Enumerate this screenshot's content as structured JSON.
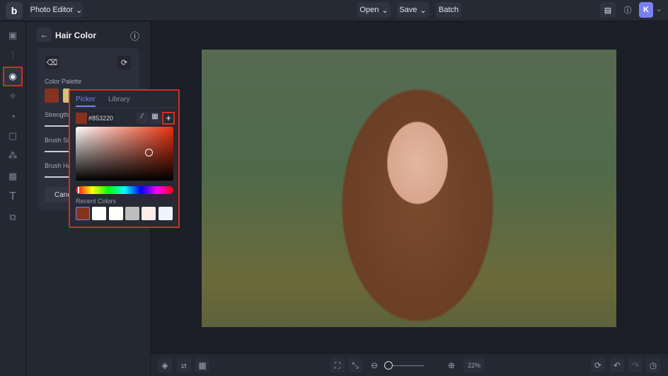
{
  "topbar": {
    "app_menu": "Photo Editor",
    "open": "Open",
    "save": "Save",
    "batch": "Batch",
    "avatar": "K"
  },
  "panel": {
    "title": "Hair Color",
    "color_palette": "Color Palette",
    "strength": "Strength",
    "brush_size": "Brush Size",
    "brush_hardness": "Brush Hardness",
    "cancel": "Cancel"
  },
  "picker": {
    "tab_picker": "Picker",
    "tab_library": "Library",
    "hex": "#853220",
    "recent_label": "Recent Colors",
    "current_color": "#853220",
    "recent_colors": [
      "#853220",
      "#ffffff",
      "#fffef8",
      "#bdbdbd",
      "#fdecea",
      "#eef6fb"
    ]
  },
  "bottom": {
    "zoom": "22%",
    "zoom_fraction": 0.05
  },
  "colors": {
    "accent": "#d42d1e",
    "tab_active": "#7a7ff0"
  }
}
